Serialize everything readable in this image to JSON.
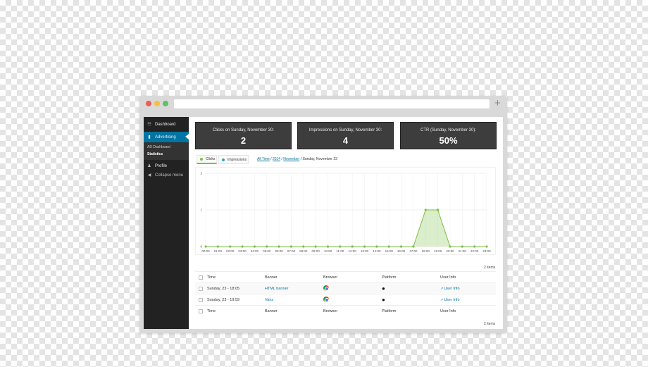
{
  "sidebar": {
    "items": [
      {
        "label": "Dashboard",
        "icon": "dashboard-icon"
      },
      {
        "label": "Advertising",
        "icon": "megaphone-icon"
      },
      {
        "label": "Profile",
        "icon": "person-icon"
      },
      {
        "label": "Collapse menu",
        "icon": "collapse-arrow-icon"
      }
    ],
    "submenu": [
      "AD Dashboard",
      "Statistics"
    ]
  },
  "stats": [
    {
      "title": "Clicks on Sunday, November 30:",
      "value": "2"
    },
    {
      "title": "Impressions on Sunday, November 30:",
      "value": "4"
    },
    {
      "title": "CTR (Sunday, November 30):",
      "value": "50%"
    }
  ],
  "tabs": [
    "Clicks",
    "Impressions"
  ],
  "breadcrumb": {
    "all_time": "All Time",
    "sep1": " / ",
    "year": "2014",
    "sep2": " / ",
    "month": "November",
    "current": " / Sunday, November 23"
  },
  "items_count": "2 items",
  "table": {
    "headers": [
      "Time",
      "Banner",
      "Browser",
      "Platform",
      "User Info"
    ],
    "rows": [
      {
        "time": "Sunday, 23 - 18:05",
        "banner": "HTML banner",
        "browser": "chrome-icon",
        "platform": "apple-icon",
        "user": "User Info"
      },
      {
        "time": "Sunday, 23 - 19:59",
        "banner": "Vans",
        "browser": "chrome-icon",
        "platform": "apple-icon",
        "user": "User Info"
      }
    ]
  },
  "colors": {
    "accent": "#0074a2",
    "series": "#7ac143",
    "sidebar": "#222222"
  },
  "chart_data": {
    "type": "area",
    "x": [
      "00:00",
      "01:00",
      "02:00",
      "03:00",
      "04:00",
      "05:00",
      "06:00",
      "07:00",
      "08:00",
      "09:00",
      "10:00",
      "11:00",
      "12:00",
      "13:00",
      "14:00",
      "15:00",
      "16:00",
      "17:00",
      "18:00",
      "19:00",
      "20:00",
      "21:00",
      "22:00",
      "23:00"
    ],
    "series": [
      {
        "name": "Clicks",
        "values": [
          0,
          0,
          0,
          0,
          0,
          0,
          0,
          0,
          0,
          0,
          0,
          0,
          0,
          0,
          0,
          0,
          0,
          0,
          1,
          1,
          0,
          0,
          0,
          0
        ]
      }
    ],
    "yticks": [
      0,
      1,
      2
    ],
    "ylim": [
      0,
      2
    ],
    "grid": true
  }
}
